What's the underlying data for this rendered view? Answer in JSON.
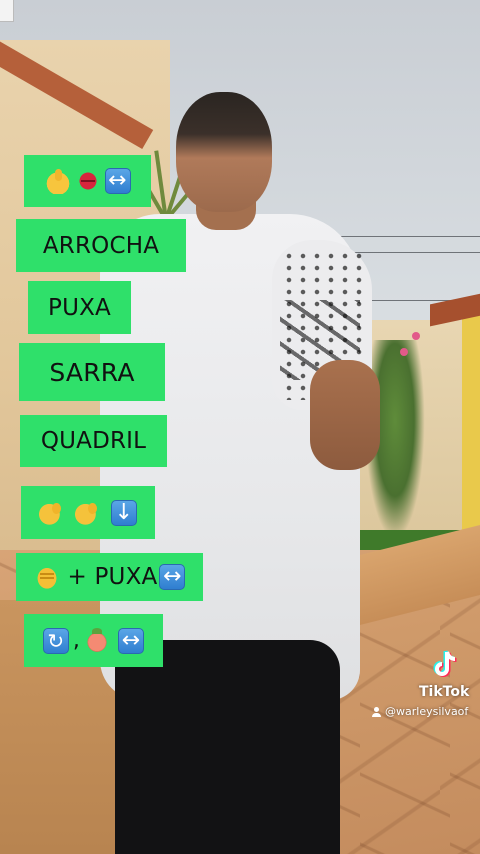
{
  "captions": [
    {
      "id": "cap-1",
      "emojis": [
        "thumbs-up-icon",
        "lips-icon",
        "left-right-arrow-icon"
      ]
    },
    {
      "id": "cap-2",
      "text": "ARROCHA"
    },
    {
      "id": "cap-3",
      "text": "PUXA"
    },
    {
      "id": "cap-4",
      "text": "SARRA"
    },
    {
      "id": "cap-5",
      "text": "QUADRIL"
    },
    {
      "id": "cap-6",
      "emojis": [
        "flexed-biceps-icon",
        "flexed-biceps-icon",
        "down-arrow-icon"
      ]
    },
    {
      "id": "cap-7",
      "prefix_emoji": "oncoming-fist-icon",
      "text": "+ PUXA",
      "suffix_emoji": "left-right-arrow-icon"
    },
    {
      "id": "cap-8",
      "emojis": [
        "cycle-arrows-icon",
        "peach-icon",
        "left-right-arrow-icon"
      ],
      "separator": ","
    }
  ],
  "colors": {
    "caption_bg": "#2fe06a",
    "caption_text": "#111111"
  },
  "watermark": {
    "brand": "TikTok",
    "username": "@warleysilvaof"
  }
}
